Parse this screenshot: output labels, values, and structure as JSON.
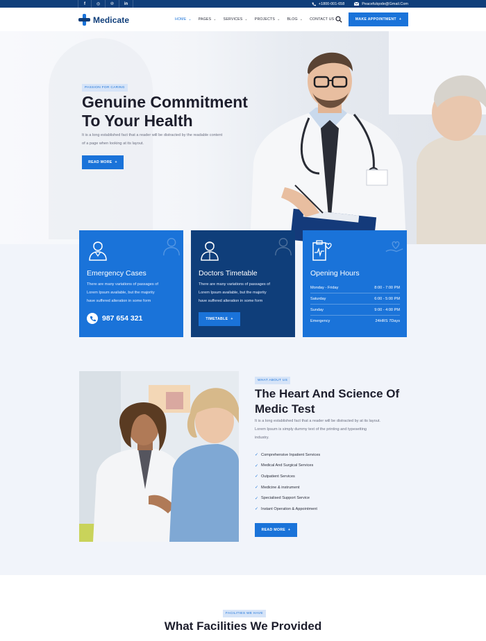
{
  "topbar": {
    "social": [
      {
        "icon": "facebook-icon",
        "glyph": "f"
      },
      {
        "icon": "instagram-icon",
        "glyph": "◎"
      },
      {
        "icon": "pinterest-icon",
        "glyph": "℗"
      },
      {
        "icon": "linkedin-icon",
        "glyph": "in"
      }
    ],
    "phone": "+1800-001-658",
    "email": "Peacefulqode@Gmail.Com"
  },
  "header": {
    "logo": "Medicate",
    "nav": [
      {
        "label": "HOME",
        "active": true,
        "dropdown": true
      },
      {
        "label": "PAGES",
        "active": false,
        "dropdown": true
      },
      {
        "label": "SERVICES",
        "active": false,
        "dropdown": true
      },
      {
        "label": "PROJECTS",
        "active": false,
        "dropdown": true
      },
      {
        "label": "BLOG",
        "active": false,
        "dropdown": true
      },
      {
        "label": "CONTACT US",
        "active": false,
        "dropdown": false
      }
    ],
    "appointment_label": "MAKE APPOINTMENT",
    "plus": "+"
  },
  "hero": {
    "tag": "PASSION FOR CARING",
    "title_line1": "Genuine Commitment",
    "title_line2": "To Your Health",
    "desc_line1": "It is a long established fact that a reader will be distracted by the readable content",
    "desc_line2": "of a page when looking at its layout.",
    "button": "READ MORE"
  },
  "cards": {
    "emergency": {
      "title": "Emergency Cases",
      "line1": "There are many variations of passages of",
      "line2": "Lorem Ipsum available, but the majority",
      "line3": "have suffered alteration in some form",
      "phone": "987 654 321"
    },
    "doctors": {
      "title": "Doctors Timetable",
      "line1": "There are many variations of passages of",
      "line2": "Lorem Ipsum available, but the majority",
      "line3": "have suffered alteration in some form",
      "button": "TIMETABLE"
    },
    "hours": {
      "title": "Opening Hours",
      "rows": [
        {
          "day": "Monday - Friday",
          "time": "8:00 - 7:00 PM"
        },
        {
          "day": "Saturday",
          "time": "6:00 - 5:00 PM"
        },
        {
          "day": "Sunday",
          "time": "9:00 - 4:00 PM"
        },
        {
          "day": "Emergency",
          "time": "24HRS 7Days"
        }
      ]
    }
  },
  "about": {
    "tag": "WHAT ABOUT US",
    "title_line1": "The Heart And Science Of",
    "title_line2": "Medic Test",
    "desc_line1": "It is a long established fact that a reader will be distracted by at its layout.",
    "desc_line2": "Lorem Ipsum is simply dummy text of the printing and typesetting",
    "desc_line3": "industry.",
    "checklist": [
      "Comprehensive Inpatient Services",
      "Medical And Surgical Services",
      "Outpatient Services",
      "Medicine & instrument",
      "Specialised Support Service",
      "Instant Operation & Appointment"
    ],
    "button": "READ MORE"
  },
  "facilities": {
    "tag": "FACILITIES WE HAVE",
    "title": "What Facilities We Provided"
  },
  "colors": {
    "primary": "#1a73d9",
    "dark": "#0f3e7a",
    "background": "#f1f4fa"
  }
}
